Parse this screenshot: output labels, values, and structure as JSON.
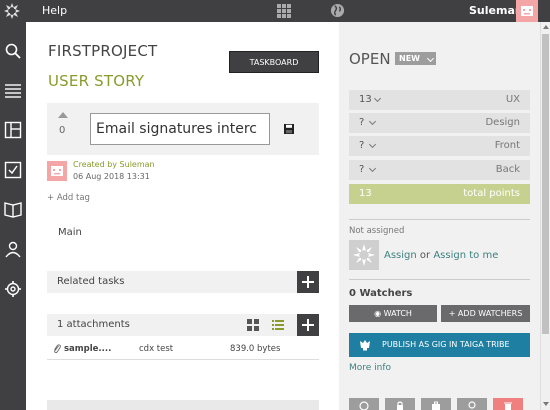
{
  "topbar": {
    "help_label": "Help",
    "user_name": "Suleman",
    "icons": [
      "taiga-logo-icon",
      "apps-grid-icon",
      "globe-icon"
    ]
  },
  "leftnav": {
    "icons": [
      "search-icon",
      "menu-icon",
      "kanban-icon",
      "checklist-icon",
      "wiki-book-icon",
      "team-icon",
      "settings-icon"
    ]
  },
  "main": {
    "project_name": "FIRSTPROJECT",
    "item_type": "USER STORY",
    "taskboard_label": "TASKBOARD",
    "votes": "0",
    "subject_value": "Email signatures interc",
    "created_by": "Created by Suleman",
    "created_date": "06 Aug 2018 13:31",
    "add_tag_label": "Add tag",
    "description": "Main",
    "related_tasks_label": "Related tasks",
    "attachments_label": "1 attachments",
    "attachment": {
      "filename": "sample....",
      "description": "cdx test",
      "size": "839.0 bytes"
    }
  },
  "sidebar": {
    "status": "OPEN",
    "status_badge": "NEW",
    "points": [
      {
        "value": "13",
        "role": "UX"
      },
      {
        "value": "?",
        "role": "Design"
      },
      {
        "value": "?",
        "role": "Front"
      },
      {
        "value": "?",
        "role": "Back"
      }
    ],
    "total": {
      "value": "13",
      "label": "total points"
    },
    "not_assigned": "Not assigned",
    "assign_label": "Assign",
    "or_label": "or",
    "assign_to_me_label": "Assign to me",
    "watchers_title": "0 Watchers",
    "watch_label": "WATCH",
    "add_watchers_label": "+ ADD WATCHERS",
    "gig_label": "PUBLISH AS GIG IN TAIGA TRIBE",
    "more_info": "More info"
  },
  "colors": {
    "dark": "#404043",
    "accent_green": "#8a9a2c",
    "teal_link": "#3e7f7f",
    "gig_blue": "#1f7fa3",
    "delete_red": "#f08080"
  }
}
